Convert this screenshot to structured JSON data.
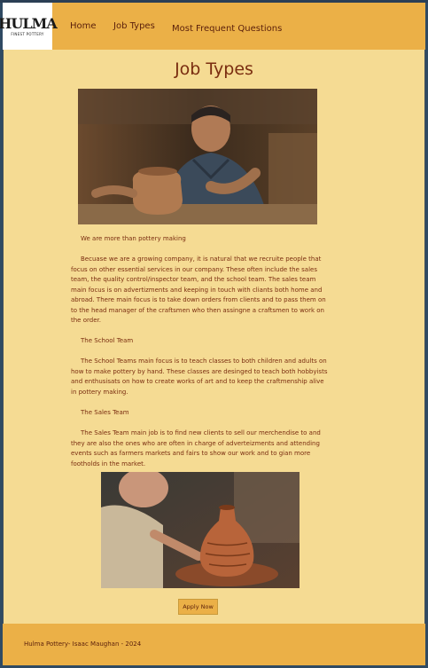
{
  "header": {
    "logo_mark": "HULMA",
    "logo_sub": "FINEST POTTERY",
    "nav": [
      "Home",
      "Job Types",
      "Most Frequent Questions"
    ]
  },
  "page_title": "Job Types",
  "content": {
    "intro_heading": "We are more than pottery making",
    "intro_paragraph": "Becuase we are a growing company, it is natural that we recruite people that focus on other essential services in our company. These often include the sales team, the quality control/inspector team, and the school team. The sales team main focus is on advertizments and keeping in touch with cliants both home and abroad. There main focus is to take down orders from clients and to pass them on to the head manager of the craftsmen who then assingne a craftsmen to work on the order.",
    "school_heading": "The School Team",
    "school_paragraph": "The School Teams main focus is to teach classes to both children and adults on how to make pottery by hand. These classes are desinged to teach both hobbyists and enthusisats on how to create works of art and to keep the craftmenship alive in pottery making.",
    "sales_heading": "The Sales Team",
    "sales_paragraph": "The Sales Team main job is to find new clients to sell our merchendise to and they are also the ones who are often in charge of adverteizments and attending events such as farmers markets and fairs to show our work and to gian more footholds in the market."
  },
  "apply_button": "Apply Now",
  "footer": "Hulma Pottery- Isaac Maughan - 2024"
}
